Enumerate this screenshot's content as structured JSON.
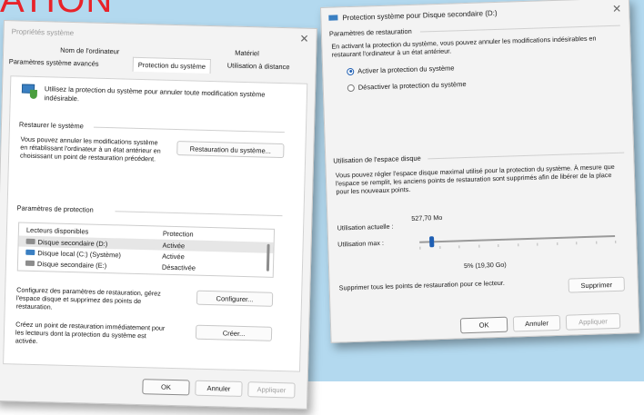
{
  "heading": "ATION",
  "window1": {
    "title": "Propriétés système",
    "tabs": [
      "Nom de l'ordinateur",
      "Matériel",
      "Paramètres système avancés",
      "Protection du système",
      "Utilisation à distance"
    ],
    "intro": "Utilisez la protection du système pour annuler toute modification système indésirable.",
    "restore": {
      "label": "Restaurer le système",
      "text": "Vous pouvez annuler les modifications système en rétablissant l'ordinateur à un état antérieur en choisissant un point de restauration précédent.",
      "button": "Restauration du système..."
    },
    "protection": {
      "label": "Paramètres de protection",
      "columns": [
        "Lecteurs disponibles",
        "Protection"
      ],
      "rows": [
        {
          "drive": "Disque secondaire (D:)",
          "status": "Activée"
        },
        {
          "drive": "Disque local (C:) (Système)",
          "status": "Activée"
        },
        {
          "drive": "Disque secondaire (E:)",
          "status": "Désactivée"
        }
      ]
    },
    "configure": {
      "text": "Configurez des paramètres de restauration, gérez l'espace disque et supprimez des points de restauration.",
      "button": "Configurer..."
    },
    "create": {
      "text": "Créez un point de restauration immédiatement pour les lecteurs dont la protection du système est activée.",
      "button": "Créer..."
    },
    "footer": {
      "ok": "OK",
      "cancel": "Annuler",
      "apply": "Appliquer"
    }
  },
  "window2": {
    "title": "Protection système pour Disque secondaire (D:)",
    "restore_label": "Paramètres de restauration",
    "restore_text": "En activant la protection du système, vous pouvez annuler les modifications indésirables en restaurant l'ordinateur à un état antérieur.",
    "radio_on": "Activer la protection du système",
    "radio_off": "Désactiver la protection du système",
    "disk_label": "Utilisation de l'espace disque",
    "disk_text": "Vous pouvez régler l'espace disque maximal utilisé pour la protection du système. À mesure que l'espace se remplit, les anciens points de restauration sont supprimés afin de libérer de la place pour les nouveaux points.",
    "current_label": "Utilisation actuelle :",
    "current_value": "527,70 Mo",
    "max_label": "Utilisation max :",
    "max_value": "5% (19,30 Go)",
    "max_fraction": 0.05,
    "delete_text": "Supprimer tous les points de restauration pour ce lecteur.",
    "delete_button": "Supprimer",
    "footer": {
      "ok": "OK",
      "cancel": "Annuler",
      "apply": "Appliquer"
    }
  }
}
